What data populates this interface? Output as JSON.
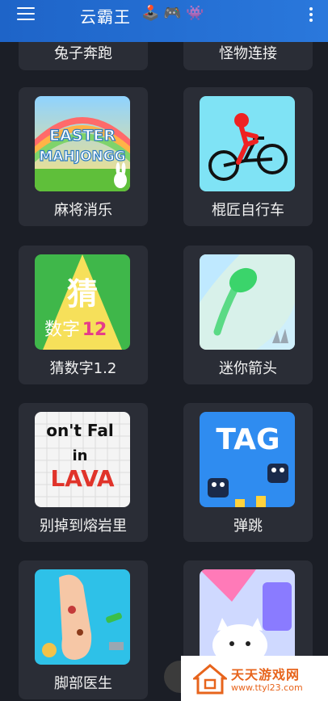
{
  "appbar": {
    "title": "云霸王",
    "icons": [
      "joystick-icon",
      "gamepad-icon",
      "alien-monster-icon"
    ],
    "emojis": [
      "🕹️",
      "🎮",
      "👾"
    ]
  },
  "games": [
    {
      "label": "兔子奔跑"
    },
    {
      "label": "怪物连接"
    },
    {
      "label": "麻将消乐",
      "art": {
        "line1": "EASTER",
        "line2": "MAHJONGG"
      }
    },
    {
      "label": "棍匠自行车"
    },
    {
      "label": "猜数字1.2",
      "art": {
        "big": "猜",
        "small": "数字",
        "nums": "12"
      }
    },
    {
      "label": "迷你箭头"
    },
    {
      "label": "别掉到熔岩里",
      "art": {
        "l1": "on't Fal",
        "l2": "in",
        "l3": "LAVA"
      }
    },
    {
      "label": "弹跳",
      "art": {
        "tag": "TAG"
      }
    },
    {
      "label": "脚部医生"
    },
    {
      "label": ""
    }
  ],
  "watermark": {
    "name": "天天游戏网",
    "url": "www.ttyl23.com"
  },
  "colors": {
    "appbar": "#2a78dc",
    "background": "#1b1e26",
    "card": "#2a2d36",
    "watermark": "#e7641c"
  }
}
